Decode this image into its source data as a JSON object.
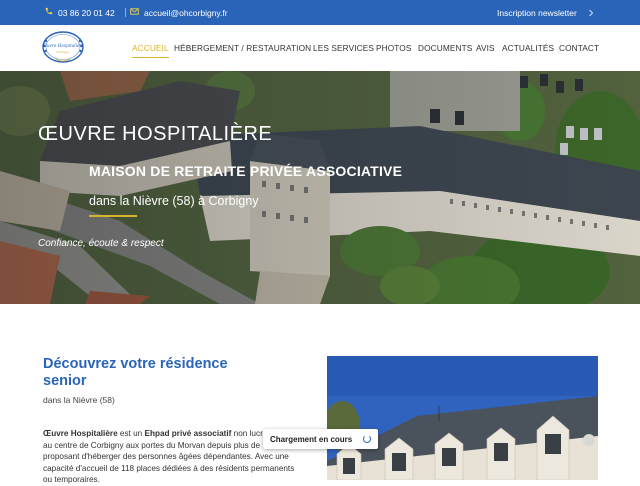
{
  "topbar": {
    "phone": "03 86 20 01 42",
    "email": "accueil@ohcorbigny.fr",
    "newsletter": "Inscription newsletter",
    "phone_icon": "phone-icon",
    "email_icon": "mail-icon",
    "newsletter_icon": "chevron-right-icon"
  },
  "logo": {
    "line1": "Œuvre Hospitalière",
    "line2": "Corbigny"
  },
  "nav": [
    {
      "label": "ACCUEIL",
      "active": true
    },
    {
      "label": "HÉBERGEMENT / RESTAURATION"
    },
    {
      "label": "LES SERVICES"
    },
    {
      "label": "PHOTOS"
    },
    {
      "label": "DOCUMENTS"
    },
    {
      "label": "AVIS"
    },
    {
      "label": "ACTUALITÉS"
    },
    {
      "label": "CONTACT"
    }
  ],
  "hero": {
    "title": "ŒUVRE HOSPITALIÈRE",
    "subtitle": "MAISON DE RETRAITE PRIVÉE ASSOCIATIVE",
    "location": "dans la Nièvre (58) à Corbigny",
    "tagline": "Confiance, écoute & respect"
  },
  "content": {
    "title": "Découvrez votre résidence senior",
    "small": "dans la Nièvre (58)",
    "para_start": "Œuvre Hospitalière",
    "para_mid1": " est un ",
    "para_bold2": "Ehpad privé associatif",
    "para_rest": " non lucratif situé au centre de Corbigny aux portes du Morvan depuis plus de 150 ans et proposant d'héberger des personnes âgées dépendantes. Avec une capacité d'accueil de 118 places dédiées à des résidents permanents ou temporaires."
  },
  "toast": {
    "label": "Chargement en cours"
  },
  "colors": {
    "primary": "#2a64b8",
    "accent": "#d6b32c"
  }
}
